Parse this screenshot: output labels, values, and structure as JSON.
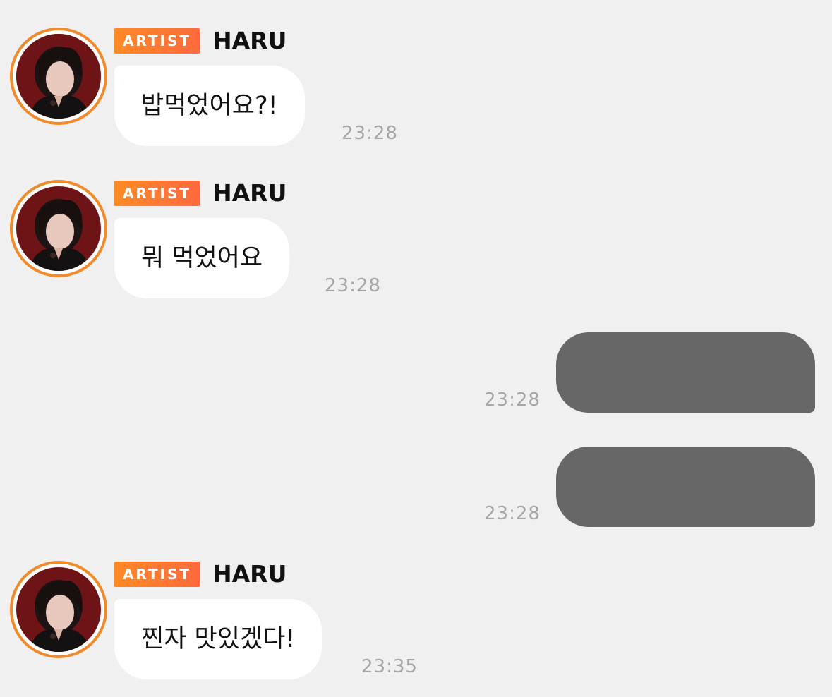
{
  "badge_label": "ARTIST",
  "messages": [
    {
      "sender": "HARU",
      "text": "밥먹었어요?!",
      "time": "23:28"
    },
    {
      "sender": "HARU",
      "text": "뭐 먹었어요",
      "time": "23:28"
    },
    {
      "time": "23:28"
    },
    {
      "time": "23:28"
    },
    {
      "sender": "HARU",
      "text": "찐자 맛있겠다!",
      "time": "23:35"
    }
  ],
  "colors": {
    "background": "#f0f0f0",
    "badge_start": "#ff8a24",
    "badge_end": "#ff6a3d",
    "avatar_ring": "#f08a2b",
    "outgoing_bubble": "#676767",
    "timestamp": "#a6a6a6"
  }
}
